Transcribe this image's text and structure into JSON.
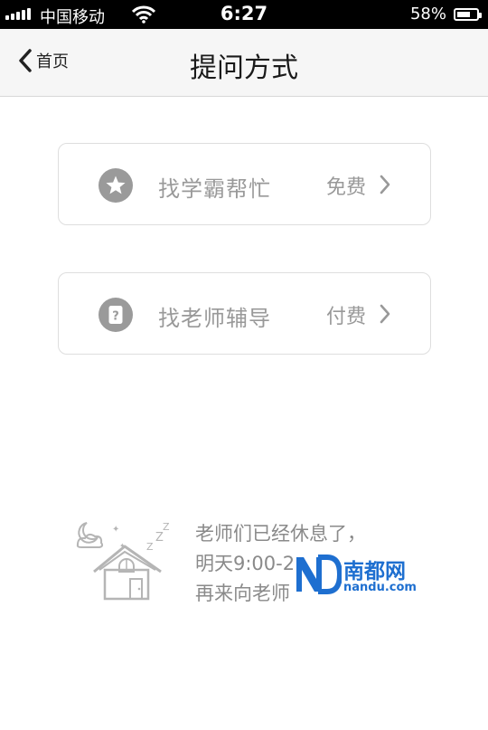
{
  "status_bar": {
    "carrier": "中国移动",
    "time": "6:27",
    "battery_percent": "58%",
    "battery_level": 0.58,
    "signal_bars": 5
  },
  "nav": {
    "back_label": "首页",
    "title": "提问方式"
  },
  "options": [
    {
      "label": "找学霸帮忙",
      "price": "免费",
      "icon": "star-icon"
    },
    {
      "label": "找老师辅导",
      "price": "付费",
      "icon": "question-icon"
    }
  ],
  "rest_notice": {
    "lines": [
      "老师们已经休息了，",
      "明天9:00-2",
      "再来向老师"
    ]
  },
  "watermark": {
    "name": "南都网",
    "domain": "nandu.com"
  },
  "colors": {
    "nav_bg": "#f6f6f6",
    "card_border": "#dedede",
    "muted_text": "#999999",
    "icon_gray": "#9a9a9a",
    "watermark_blue": "#1e6fd0"
  }
}
